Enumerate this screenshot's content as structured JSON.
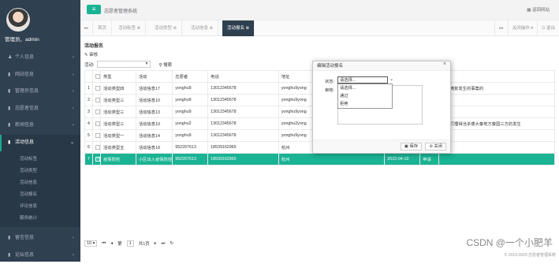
{
  "sidebar": {
    "user": "管理员、admin",
    "items": [
      {
        "label": "个人信息",
        "icon": "user-icon",
        "active": false
      },
      {
        "label": "网站信息",
        "icon": "gear-icon",
        "active": false
      },
      {
        "label": "管理员信息",
        "icon": "gear-icon",
        "active": false
      },
      {
        "label": "志愿者信息",
        "icon": "gear-icon",
        "active": false
      },
      {
        "label": "新闻信息",
        "icon": "gear-icon",
        "active": false
      },
      {
        "label": "活动信息",
        "icon": "gear-icon",
        "active": true
      }
    ],
    "subitems": [
      "活动标签",
      "活动类型",
      "活动信息",
      "活动报名",
      "评论信息",
      "服务统计"
    ],
    "bottom_items": [
      {
        "label": "留言信息",
        "icon": "gear-icon"
      },
      {
        "label": "论坛信息",
        "icon": "gear-icon"
      }
    ]
  },
  "topbar": {
    "menu_icon": "menu-icon",
    "title": "志愿者管理系统",
    "home": "返回网站"
  },
  "tabs": [
    "首页",
    "活动标签",
    "活动类型",
    "活动信息",
    "活动报名"
  ],
  "tabs_right": {
    "action": "关闭操作",
    "exit": "退出"
  },
  "panel": {
    "title": "活动报名",
    "edit": "审核",
    "filter_label": "活动:",
    "search": "搜索"
  },
  "table": {
    "columns": [
      "",
      "",
      "类型",
      "活动",
      "志愿者",
      "电话",
      "地址",
      "",
      "",
      ""
    ],
    "rows": [
      {
        "no": "1",
        "type": "活动类型四",
        "act": "活动信息17",
        "vol": "yonghu9",
        "tel": "13012345678",
        "addr": "yonghu9yong",
        "extra": "上大精复发生的事案的"
      },
      {
        "no": "2",
        "type": "活动类型三",
        "act": "活动信息10",
        "vol": "yonghu9",
        "tel": "13012345678",
        "addr": "yonghu9yong",
        "extra": ""
      },
      {
        "no": "3",
        "type": "活动类型三",
        "act": "活动信息13",
        "vol": "yonghu9",
        "tel": "13012345678",
        "addr": "yonghu9yong",
        "extra": ""
      },
      {
        "no": "4",
        "type": "活动类型三",
        "act": "活动信息19",
        "vol": "yonghu2",
        "tel": "13012345678",
        "addr": "yonghu2yong",
        "extra": "发现打擂得当杀倭大秦地方秦国三方的发生"
      },
      {
        "no": "5",
        "type": "活动类型一",
        "act": "活动信息14",
        "vol": "yonghu9",
        "tel": "13012345678",
        "addr": "yonghu9yong",
        "extra": ""
      },
      {
        "no": "6",
        "type": "活动类型五",
        "act": "活动信息18",
        "vol": "952207613",
        "tel": "18539162965",
        "addr": "杭州",
        "extra": ""
      },
      {
        "no": "7",
        "type": "疫情防控",
        "act": "小区出入疫情防控",
        "vol": "952207613",
        "tel": "18539162965",
        "addr": "杭州",
        "date": "2022-04-10",
        "status": "申请",
        "extra": "",
        "selected": true
      }
    ]
  },
  "pager": {
    "size": "10",
    "page": "1",
    "of": "共1页"
  },
  "footer": "© 2019-2020 志愿者管理系统",
  "watermark": "CSDN @一个小肥羊",
  "modal": {
    "title": "编辑活动报名",
    "status_label": "状态:",
    "review_label": "审核:",
    "selected": "请选择...",
    "options": [
      "请选择...",
      "通过",
      "拒绝"
    ],
    "save": "保存",
    "close": "关闭"
  }
}
